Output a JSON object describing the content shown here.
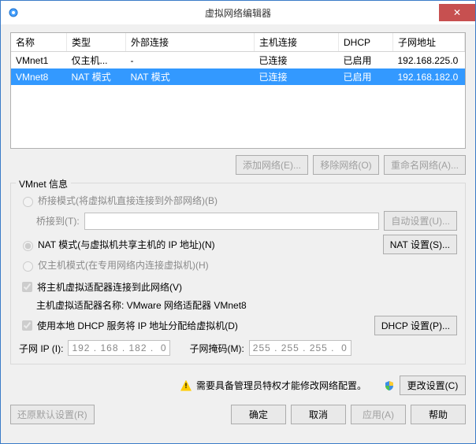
{
  "window": {
    "title": "虚拟网络编辑器",
    "close_glyph": "✕"
  },
  "table": {
    "cols": [
      "名称",
      "类型",
      "外部连接",
      "主机连接",
      "DHCP",
      "子网地址"
    ],
    "rows": [
      {
        "name": "VMnet1",
        "type": "仅主机...",
        "ext": "-",
        "host": "已连接",
        "dhcp": "已启用",
        "subnet": "192.168.225.0",
        "selected": false
      },
      {
        "name": "VMnet8",
        "type": "NAT 模式",
        "ext": "NAT 模式",
        "host": "已连接",
        "dhcp": "已启用",
        "subnet": "192.168.182.0",
        "selected": true
      }
    ]
  },
  "buttons": {
    "add_net": "添加网络(E)...",
    "remove_net": "移除网络(O)",
    "rename_net": "重命名网络(A)...",
    "auto_set": "自动设置(U)...",
    "nat_set": "NAT 设置(S)...",
    "dhcp_set": "DHCP 设置(P)...",
    "change_set": "更改设置(C)",
    "restore": "还原默认设置(R)",
    "ok": "确定",
    "cancel": "取消",
    "apply": "应用(A)",
    "help": "帮助"
  },
  "group": {
    "title": "VMnet 信息",
    "bridge_label": "桥接模式(将虚拟机直接连接到外部网络)(B)",
    "bridge_to": "桥接到(T):",
    "nat_label": "NAT 模式(与虚拟机共享主机的 IP 地址)(N)",
    "host_only_label": "仅主机模式(在专用网络内连接虚拟机)(H)",
    "connect_host": "将主机虚拟适配器连接到此网络(V)",
    "adapter_name": "主机虚拟适配器名称: VMware 网络适配器 VMnet8",
    "use_dhcp": "使用本地 DHCP 服务将 IP 地址分配给虚拟机(D)",
    "subnet_ip_label": "子网 IP (I):",
    "subnet_ip": "192 . 168 . 182 .  0",
    "mask_label": "子网掩码(M):",
    "mask": "255 . 255 . 255 .  0"
  },
  "warn": "需要具备管理员特权才能修改网络配置。"
}
